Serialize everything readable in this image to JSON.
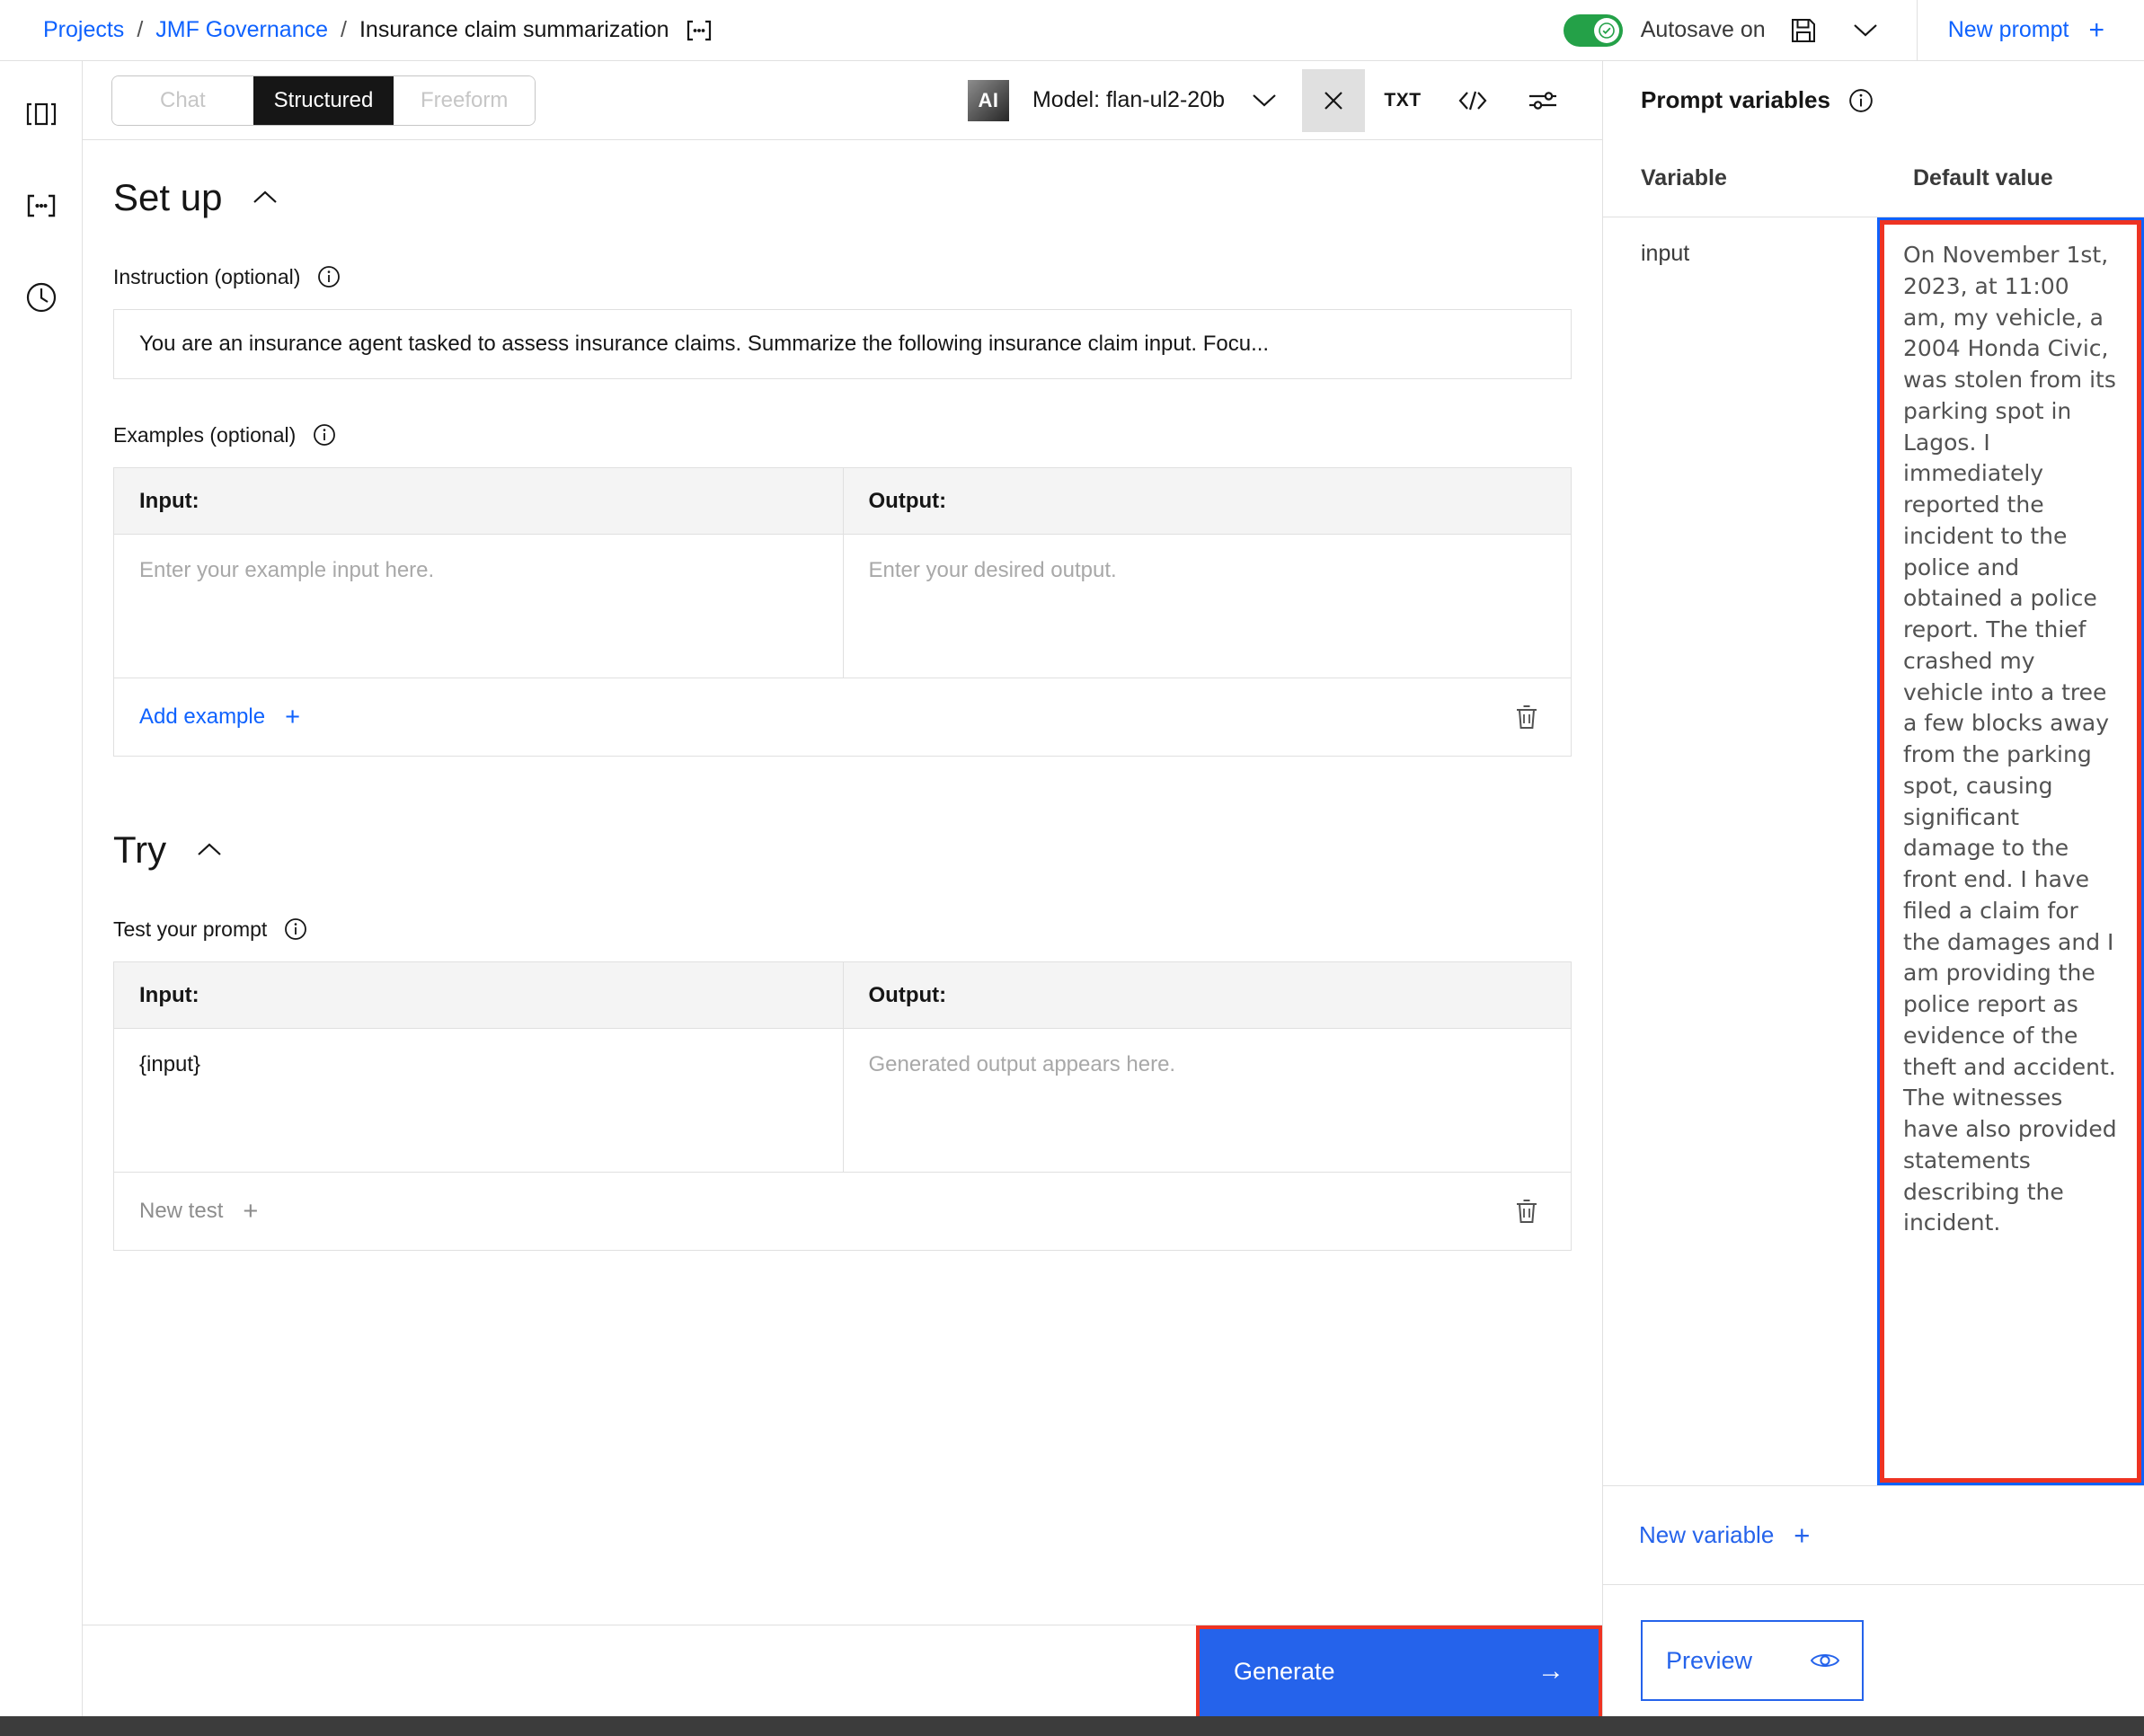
{
  "breadcrumb": {
    "projects": "Projects",
    "separator": "/",
    "project": "JMF Governance",
    "current": "Insurance claim summarization",
    "variable_icon": "variables-brackets-icon"
  },
  "topbar": {
    "autosave_label": "Autosave on",
    "autosave_on": true,
    "save_icon": "save-disk-icon",
    "caret_icon": "chevron-down-icon",
    "new_prompt_label": "New prompt",
    "new_prompt_plus": "+",
    "accent_blue": "#0f62fe",
    "toggle_green": "#24a148"
  },
  "rail": {
    "items": [
      {
        "name": "panel-layout-icon",
        "label": "Prompt layout"
      },
      {
        "name": "variables-brackets-icon",
        "label": "Prompt variables"
      },
      {
        "name": "history-clock-icon",
        "label": "History"
      }
    ]
  },
  "modebar": {
    "tabs": [
      {
        "label": "Chat",
        "active": false
      },
      {
        "label": "Structured",
        "active": true
      },
      {
        "label": "Freeform",
        "active": false
      }
    ],
    "ai_badge": "AI",
    "model_label": "Model: flan-ul2-20b",
    "model_caret": "chevron-down-icon",
    "close_icon": "close-x-icon",
    "txt_label": "TXT",
    "code_icon": "code-brackets-icon",
    "settings_icon": "sliders-settings-icon"
  },
  "setup": {
    "title": "Set up",
    "collapse_icon": "chevron-up-icon",
    "instruction_label": "Instruction (optional)",
    "instruction_info": "info-icon",
    "instruction_value": "You are an insurance agent tasked to assess insurance claims. Summarize the following insurance claim input. Focu...",
    "examples_label": "Examples (optional)",
    "examples_info": "info-icon",
    "col_input": "Input:",
    "col_output": "Output:",
    "example_input_placeholder": "Enter your example input here.",
    "example_output_placeholder": "Enter your desired output.",
    "add_example_label": "Add example",
    "add_example_plus": "+",
    "delete_icon": "trash-icon"
  },
  "try": {
    "title": "Try",
    "collapse_icon": "chevron-up-icon",
    "test_label": "Test your prompt",
    "test_info": "info-icon",
    "col_input": "Input:",
    "col_output": "Output:",
    "test_input_value": "{input}",
    "test_output_placeholder": "Generated output appears here.",
    "new_test_label": "New test",
    "new_test_plus": "+",
    "delete_icon": "trash-icon"
  },
  "generate": {
    "label": "Generate",
    "arrow": "→",
    "bg": "#2563eb",
    "highlight": "#ee3322"
  },
  "right_panel": {
    "title": "Prompt variables",
    "info_icon": "info-icon",
    "col_variable": "Variable",
    "col_default": "Default value",
    "rows": [
      {
        "variable": "input",
        "default_value": "On November 1st, 2023, at 11:00 am, my vehicle, a 2004 Honda Civic, was stolen from its parking spot in Lagos. I immediately reported the incident to the police and obtained a police report. The thief crashed my vehicle into a tree a few blocks away from the parking spot, causing significant damage to the front end. I have filed a claim for the damages and I am providing the police report as evidence of the theft and accident. The witnesses have also provided statements describing the incident.",
        "focused": true,
        "highlighted": true
      }
    ],
    "new_variable_label": "New variable",
    "new_variable_plus": "+",
    "preview_label": "Preview",
    "preview_icon": "eye-icon"
  }
}
